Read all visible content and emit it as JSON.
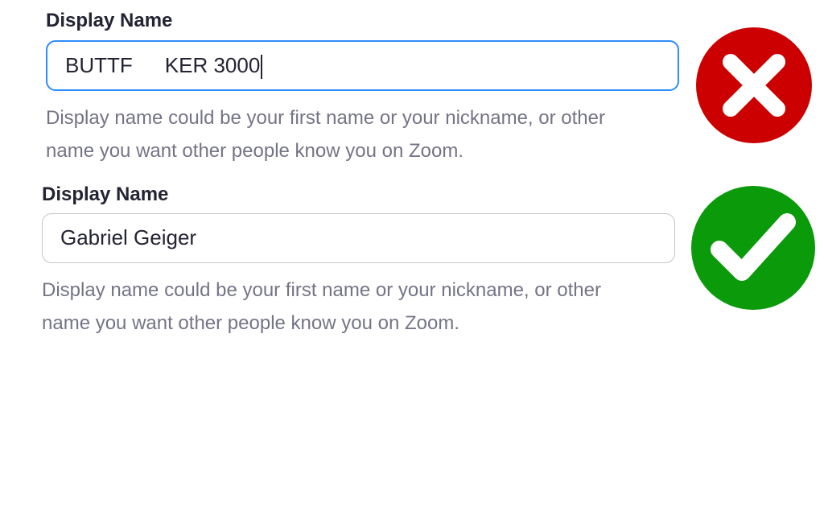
{
  "fields": [
    {
      "label": "Display Name",
      "value_part1": "BUTTF",
      "value_part2": "KER 3000",
      "help_line1": "Display name could be your first name or your nickname, or other",
      "help_line2": "name you want other people know you on Zoom.",
      "status_icon": "x-icon",
      "status_color": "#cc0000"
    },
    {
      "label": "Display Name",
      "value": "Gabriel Geiger",
      "help_line1": "Display name could be your first name or your nickname, or other",
      "help_line2": "name you want other people know you on Zoom.",
      "status_icon": "checkmark-icon",
      "status_color": "#0a9a0a"
    }
  ],
  "colors": {
    "focus_border": "#2d8cff",
    "label_text": "#232333",
    "help_text": "#747487"
  }
}
